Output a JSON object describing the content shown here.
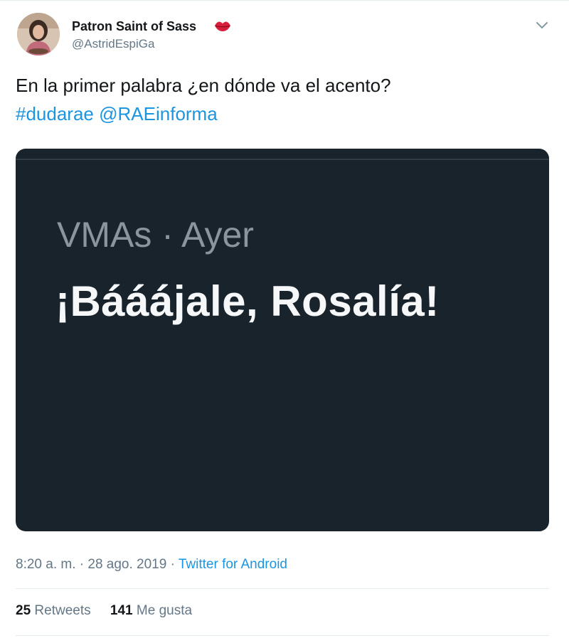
{
  "tweet": {
    "author": {
      "display_name": "Patron Saint of Sass",
      "emoji_icon": "kiss-mark-icon",
      "handle": "@AstridEspiGa"
    },
    "text": {
      "line1": "En la primer palabra ¿en dónde va el acento?",
      "hashtag": "#dudarae",
      "mention": "@RAEinforma"
    },
    "media": {
      "meta": "VMAs · Ayer",
      "headline": "¡Báááj​ale, Rosalía!"
    },
    "meta": {
      "time_date": "8:20 a. m. · 28 ago. 2019 · ",
      "source": "Twitter for Android"
    },
    "stats": {
      "retweets_count": "25",
      "retweets_label": "Retweets",
      "likes_count": "141",
      "likes_label": "Me gusta"
    }
  },
  "colors": {
    "link": "#1b95e0",
    "secondary_text": "#657786",
    "media_background": "#18232b"
  }
}
